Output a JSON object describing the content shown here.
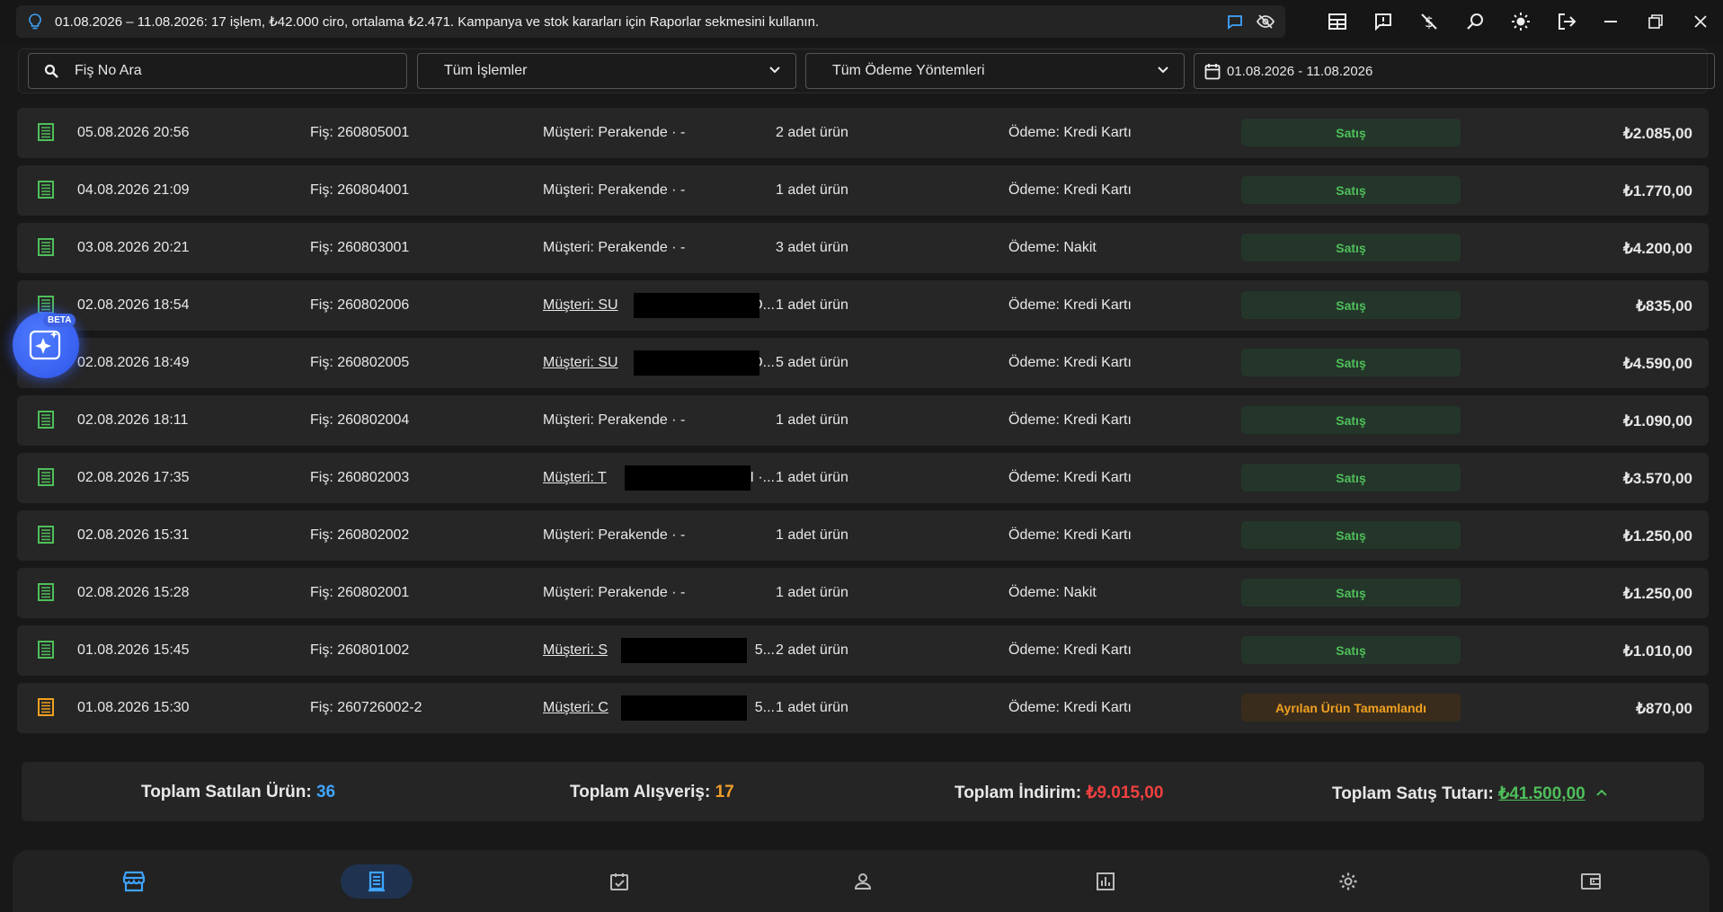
{
  "tip": {
    "text": "01.08.2026 – 11.08.2026: 17 işlem, ₺42.000 ciro, ortalama ₺2.471. Kampanya ve stok kararları için Raporlar sekmesini kullanın."
  },
  "filters": {
    "search_placeholder": "Fiş No Ara",
    "operations": "Tüm İşlemler",
    "payment_methods": "Tüm Ödeme Yöntemleri",
    "date_range": "01.08.2026 - 11.08.2026"
  },
  "ai_button": {
    "badge": "BETA"
  },
  "rows": [
    {
      "date": "05.08.2026 20:56",
      "fis": "Fiş: 260805001",
      "customer": "Müşteri: Perakende · -",
      "items": "2 adet ürün",
      "payment": "Ödeme: Kredi Kartı",
      "status": "Satış",
      "total": "₺2.085,00"
    },
    {
      "date": "04.08.2026 21:09",
      "fis": "Fiş: 260804001",
      "customer": "Müşteri: Perakende · -",
      "items": "1 adet ürün",
      "payment": "Ödeme: Kredi Kartı",
      "status": "Satış",
      "total": "₺1.770,00"
    },
    {
      "date": "03.08.2026 20:21",
      "fis": "Fiş: 260803001",
      "customer": "Müşteri: Perakende · -",
      "items": "3 adet ürün",
      "payment": "Ödeme: Nakit",
      "status": "Satış",
      "total": "₺4.200,00"
    },
    {
      "date": "02.08.2026 18:54",
      "fis": "Fiş: 260802006",
      "customer": "Müşteri: SU",
      "customer_tail": "D...",
      "items": "1 adet ürün",
      "payment": "Ödeme: Kredi Kartı",
      "status": "Satış",
      "total": "₺835,00"
    },
    {
      "date": "02.08.2026 18:49",
      "fis": "Fiş: 260802005",
      "customer": "Müşteri: SU",
      "customer_tail": "D...",
      "items": "5 adet ürün",
      "payment": "Ödeme: Kredi Kartı",
      "status": "Satış",
      "total": "₺4.590,00"
    },
    {
      "date": "02.08.2026 18:11",
      "fis": "Fiş: 260802004",
      "customer": "Müşteri: Perakende · -",
      "items": "1 adet ürün",
      "payment": "Ödeme: Kredi Kartı",
      "status": "Satış",
      "total": "₺1.090,00"
    },
    {
      "date": "02.08.2026 17:35",
      "fis": "Fiş: 260802003",
      "customer": "Müşteri: T",
      "customer_tail": "I ·...",
      "items": "1 adet ürün",
      "payment": "Ödeme: Kredi Kartı",
      "status": "Satış",
      "total": "₺3.570,00"
    },
    {
      "date": "02.08.2026 15:31",
      "fis": "Fiş: 260802002",
      "customer": "Müşteri: Perakende · -",
      "items": "1 adet ürün",
      "payment": "Ödeme: Kredi Kartı",
      "status": "Satış",
      "total": "₺1.250,00"
    },
    {
      "date": "02.08.2026 15:28",
      "fis": "Fiş: 260802001",
      "customer": "Müşteri: Perakende · -",
      "items": "1 adet ürün",
      "payment": "Ödeme: Nakit",
      "status": "Satış",
      "total": "₺1.250,00"
    },
    {
      "date": "01.08.2026 15:45",
      "fis": "Fiş: 260801002",
      "customer": "Müşteri: S",
      "customer_tail": "5...",
      "items": "2 adet ürün",
      "payment": "Ödeme: Kredi Kartı",
      "status": "Satış",
      "total": "₺1.010,00"
    },
    {
      "date": "01.08.2026 15:30",
      "fis": "Fiş: 260726002-2",
      "customer": "Müşteri: C",
      "customer_tail": "5...",
      "items": "1 adet ürün",
      "payment": "Ödeme: Kredi Kartı",
      "status": "Ayrılan Ürün Tamamlandı",
      "total": "₺870,00"
    }
  ],
  "summary": {
    "sold_label": "Toplam Satılan Ürün:",
    "sold_value": "36",
    "shopping_label": "Toplam Alışveriş:",
    "shopping_value": "17",
    "discount_label": "Toplam İndirim:",
    "discount_value": "₺9.015,00",
    "sales_label": "Toplam Satış Tutarı:",
    "sales_value": "₺41.500,00"
  },
  "colors": {
    "accent": "#3fa4ff",
    "sale_green": "#4fbf5a",
    "reserved_orange": "#f0a020",
    "discount_red": "#f04040"
  }
}
